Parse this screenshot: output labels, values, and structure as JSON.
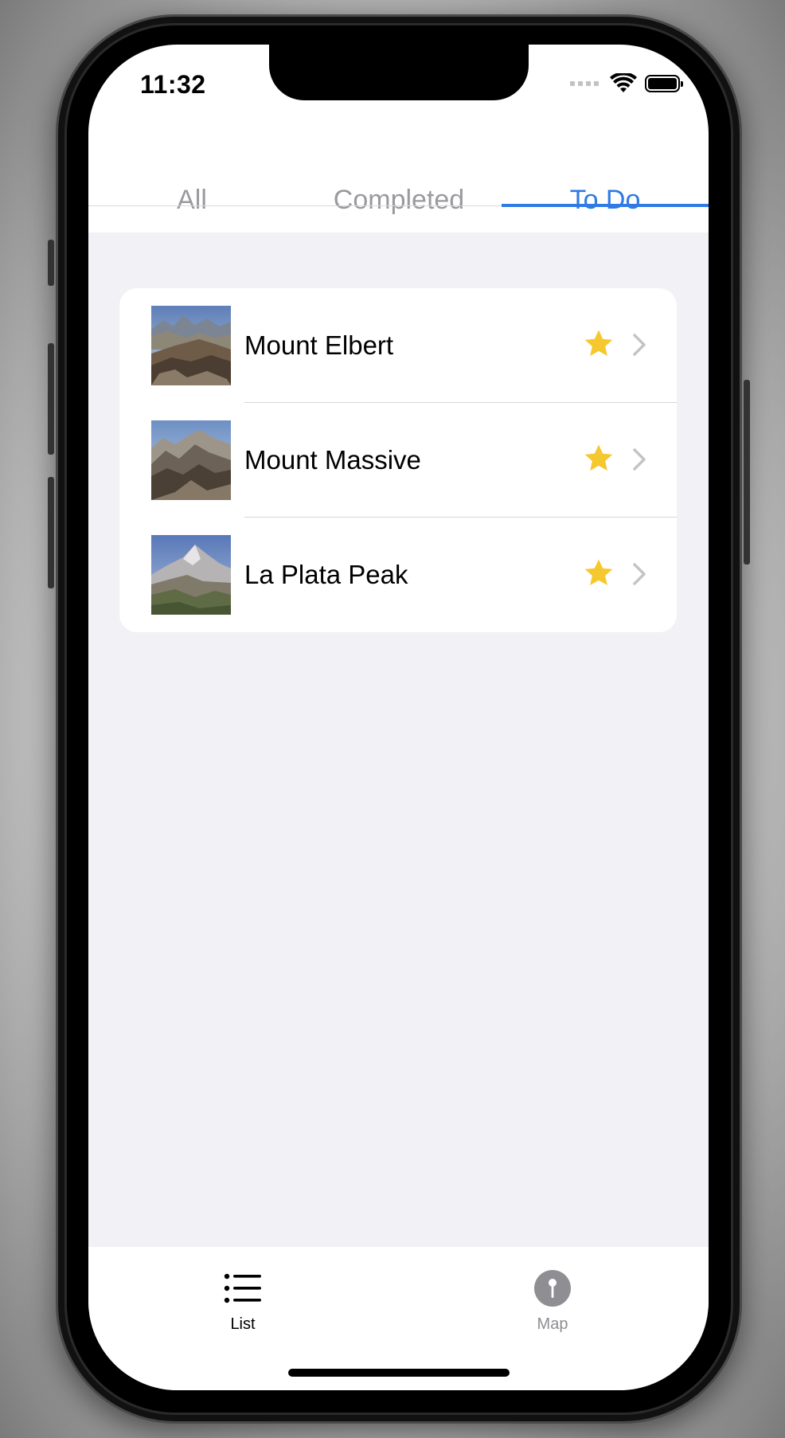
{
  "status_bar": {
    "time": "11:32",
    "icons": [
      "cellular-signal-icon",
      "wifi-icon",
      "battery-icon"
    ]
  },
  "segment_tabs": [
    {
      "label": "All",
      "selected": false
    },
    {
      "label": "Completed",
      "selected": false
    },
    {
      "label": "To Do",
      "selected": true
    }
  ],
  "list": {
    "items": [
      {
        "name": "Mount Elbert",
        "favorite": true,
        "icons": [
          "star-icon",
          "chevron-right-icon"
        ]
      },
      {
        "name": "Mount Massive",
        "favorite": true,
        "icons": [
          "star-icon",
          "chevron-right-icon"
        ]
      },
      {
        "name": "La Plata Peak",
        "favorite": true,
        "icons": [
          "star-icon",
          "chevron-right-icon"
        ]
      }
    ]
  },
  "tab_bar": {
    "items": [
      {
        "label": "List",
        "icon": "list-icon",
        "selected": true
      },
      {
        "label": "Map",
        "icon": "map-pin-icon",
        "selected": false
      }
    ]
  },
  "colors": {
    "accent": "#2f7ae5",
    "star": "#f5c830",
    "background_grouped": "#f1f1f6",
    "inactive_text": "#999a9e"
  }
}
